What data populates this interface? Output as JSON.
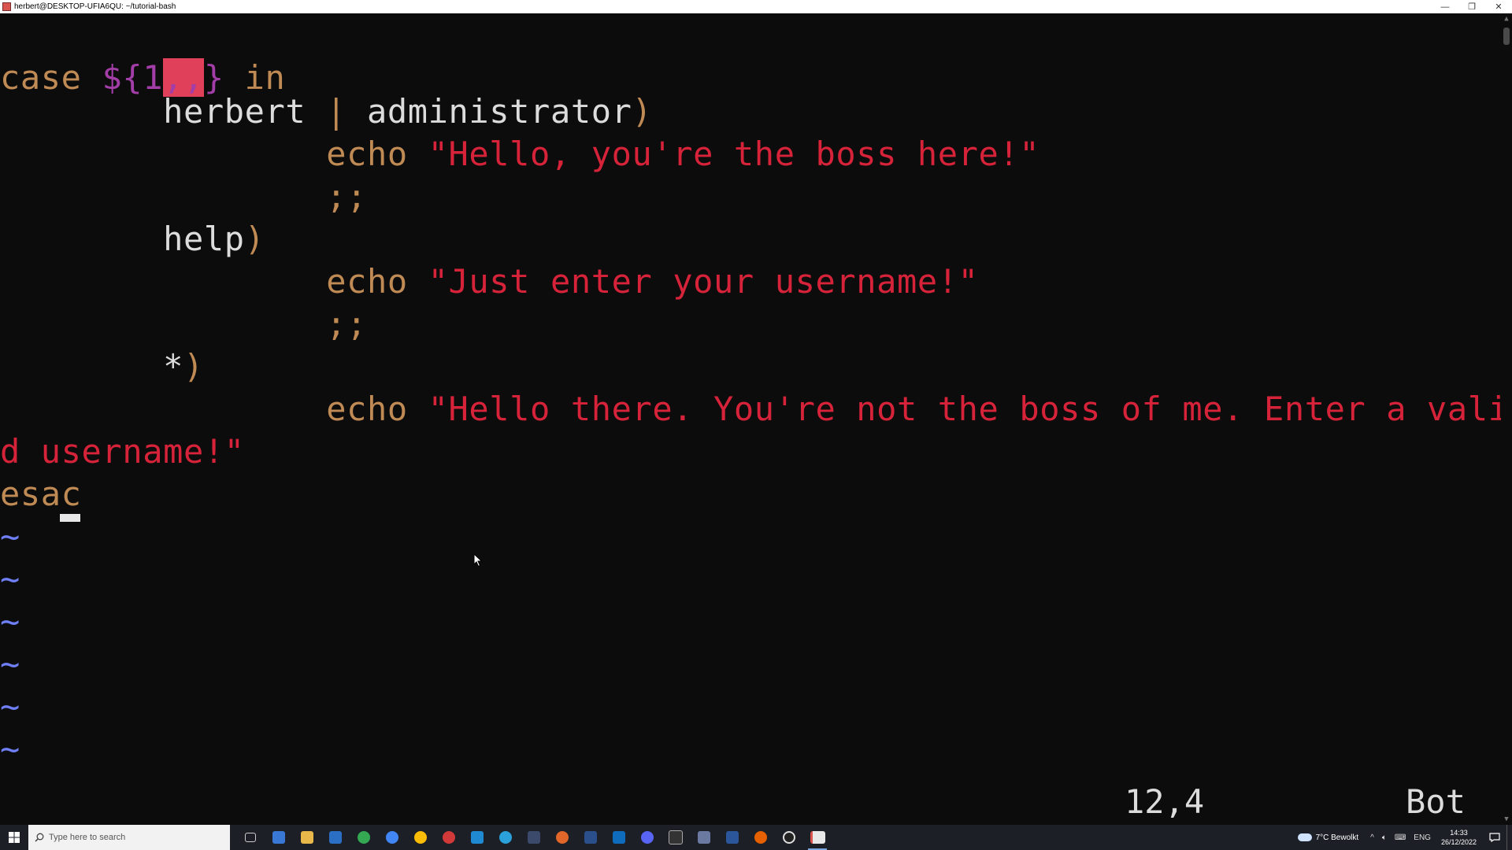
{
  "window": {
    "title": "herbert@DESKTOP-UFIA6QU: ~/tutorial-bash",
    "minimize_glyph": "—",
    "restore_glyph": "❐",
    "close_glyph": "✕"
  },
  "editor": {
    "line1": {
      "kw_case": "case",
      "var_open": "${1",
      "var_sel": ",,",
      "var_close": "}",
      "kw_in": " in"
    },
    "line2": {
      "indent": "        ",
      "pattern": "herbert",
      "pipe": " | ",
      "alt": "administrator",
      "paren": ")"
    },
    "line3": {
      "indent": "                ",
      "cmd": "echo",
      "str": "\"Hello, you're the boss here!\""
    },
    "line4": {
      "indent": "                ",
      "text": ";;"
    },
    "line5": {
      "indent": "        ",
      "pattern": "help",
      "paren": ")"
    },
    "line6": {
      "indent": "                ",
      "cmd": "echo",
      "str": "\"Just enter your username!\""
    },
    "line7": {
      "indent": "                ",
      "text": ";;"
    },
    "line8": {
      "indent": "        ",
      "pattern": "*",
      "paren": ")"
    },
    "line9": {
      "indent": "                ",
      "cmd": "echo",
      "str": "\"Hello there. You're not the boss of me. Enter a vali"
    },
    "line10": {
      "str": "d username!\""
    },
    "line11": {
      "kw": "esac"
    },
    "tilde": "~"
  },
  "status": {
    "position": "12,4",
    "scroll": "Bot"
  },
  "taskbar": {
    "search_placeholder": "Type here to search",
    "weather": "7°C  Bewolkt",
    "language": "ENG",
    "time": "14:33",
    "date": "26/12/2022"
  },
  "colors": {
    "keyword": "#c08a54",
    "variable": "#a33ea8",
    "string": "#d6233a",
    "tilde": "#6f7ff8",
    "background": "#0c0c0c"
  }
}
